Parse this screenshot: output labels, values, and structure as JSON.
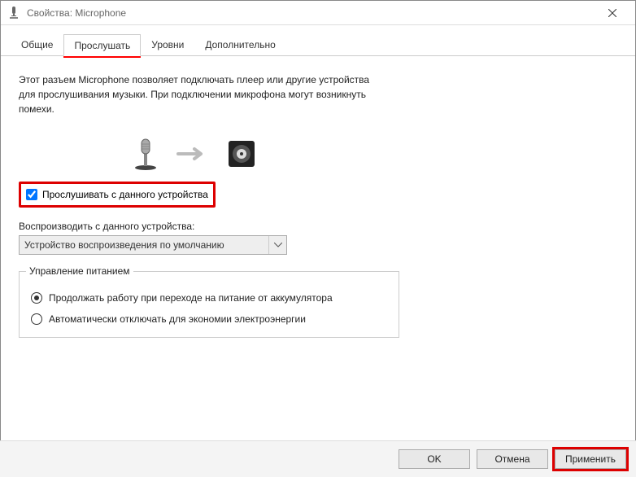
{
  "window": {
    "title": "Свойства: Microphone"
  },
  "tabs": {
    "general": "Общие",
    "listen": "Прослушать",
    "levels": "Уровни",
    "advanced": "Дополнительно"
  },
  "content": {
    "description": "Этот разъем Microphone позволяет подключать плеер или другие устройства для прослушивания музыки. При подключении микрофона могут возникнуть помехи.",
    "listen_checkbox_label": "Прослушивать с данного устройства",
    "playback_label": "Воспроизводить с данного устройства:",
    "playback_selected": "Устройство воспроизведения по умолчанию",
    "power_legend": "Управление питанием",
    "radio_continue": "Продолжать работу при переходе на питание от аккумулятора",
    "radio_auto_off": "Автоматически отключать для экономии электроэнергии"
  },
  "buttons": {
    "ok": "OK",
    "cancel": "Отмена",
    "apply": "Применить"
  }
}
